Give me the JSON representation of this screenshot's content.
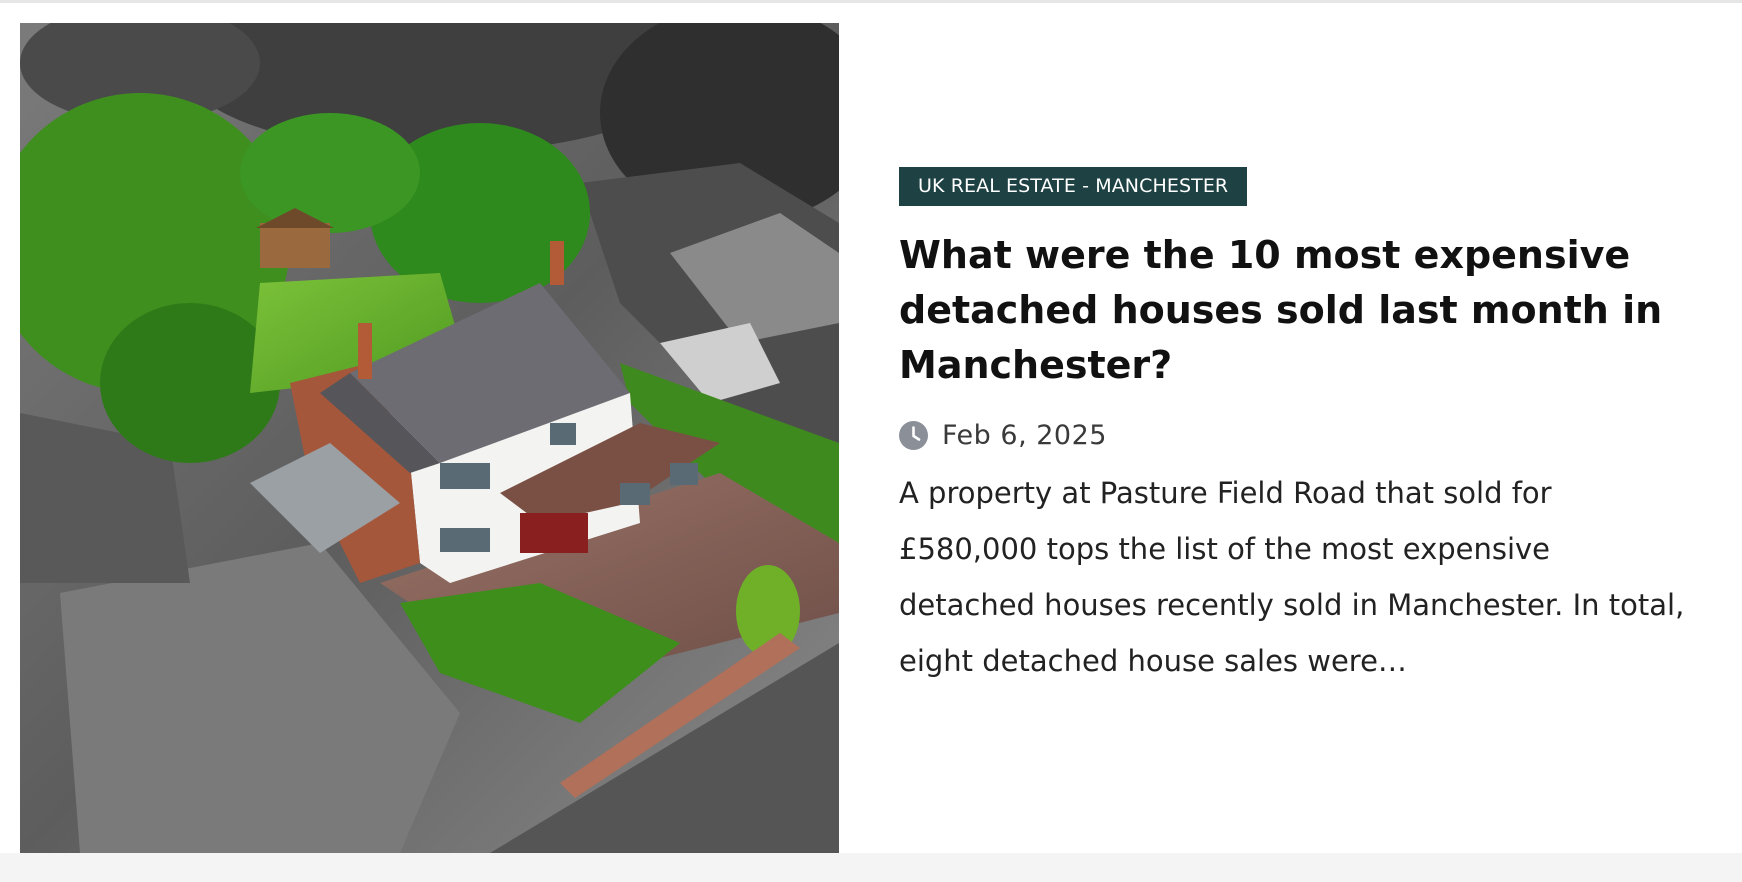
{
  "article": {
    "image_alt": "Aerial view of a detached house with a garden",
    "category": "UK REAL ESTATE - MANCHESTER",
    "title": "What were the 10 most expensive detached houses sold last month in Manchester?",
    "date": "Feb 6, 2025",
    "excerpt": "A property at Pasture Field Road that sold for £580,000 tops the list of the most expensive detached houses recently sold in Manchester. In total, eight detached house sales were…"
  },
  "colors": {
    "category_bg": "#1e4143",
    "clock_icon": "#8a8f98",
    "title_text": "#111111"
  },
  "icons": {
    "date_icon": "clock-icon"
  }
}
